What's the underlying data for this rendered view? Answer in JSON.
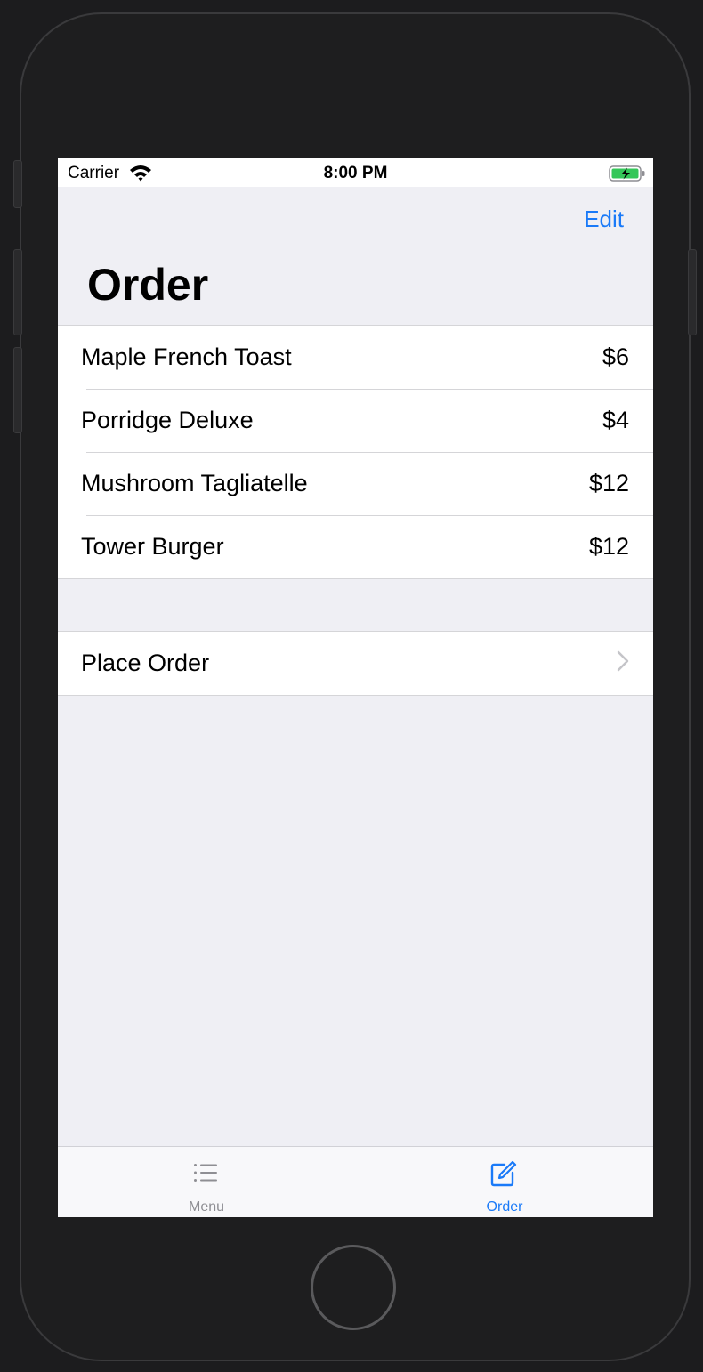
{
  "status_bar": {
    "carrier": "Carrier",
    "time": "8:00 PM"
  },
  "nav": {
    "edit_label": "Edit",
    "title": "Order"
  },
  "order_items": [
    {
      "name": "Maple French Toast",
      "price": "$6"
    },
    {
      "name": "Porridge Deluxe",
      "price": "$4"
    },
    {
      "name": "Mushroom Tagliatelle",
      "price": "$12"
    },
    {
      "name": "Tower Burger",
      "price": "$12"
    }
  ],
  "place_order": {
    "label": "Place Order"
  },
  "tabs": [
    {
      "label": "Menu",
      "icon": "list-icon",
      "active": false
    },
    {
      "label": "Order",
      "icon": "compose-icon",
      "active": true
    }
  ],
  "colors": {
    "accent": "#1a7af8",
    "inactive_tab": "#8e8e93",
    "background": "#efeff4",
    "battery": "#34c759"
  }
}
